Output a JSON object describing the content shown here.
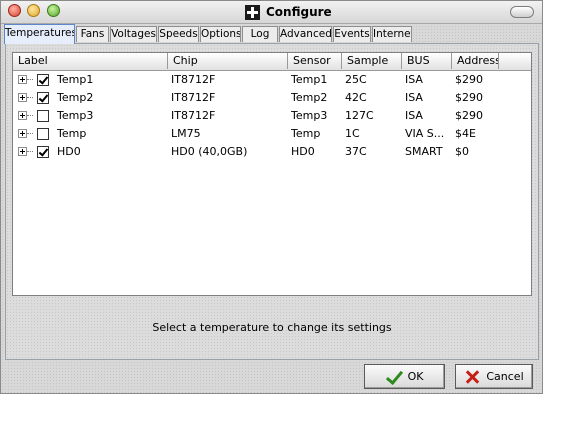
{
  "window": {
    "title": "Configure"
  },
  "tabs": [
    {
      "label": "Temperatures",
      "active": true
    },
    {
      "label": "Fans"
    },
    {
      "label": "Voltages"
    },
    {
      "label": "Speeds"
    },
    {
      "label": "Options"
    },
    {
      "label": "Log"
    },
    {
      "label": "Advanced"
    },
    {
      "label": "Events"
    },
    {
      "label": "Internet"
    }
  ],
  "table": {
    "columns": [
      "Label",
      "Chip",
      "Sensor",
      "Sample",
      "BUS",
      "Address"
    ],
    "rows": [
      {
        "checked": true,
        "label": "Temp1",
        "chip": "IT8712F",
        "sensor": "Temp1",
        "sample": "25C",
        "bus": "ISA",
        "address": "$290"
      },
      {
        "checked": true,
        "label": "Temp2",
        "chip": "IT8712F",
        "sensor": "Temp2",
        "sample": "42C",
        "bus": "ISA",
        "address": "$290"
      },
      {
        "checked": false,
        "label": "Temp3",
        "chip": "IT8712F",
        "sensor": "Temp3",
        "sample": "127C",
        "bus": "ISA",
        "address": "$290"
      },
      {
        "checked": false,
        "label": "Temp",
        "chip": "LM75",
        "sensor": "Temp",
        "sample": "1C",
        "bus": "VIA S...",
        "address": "$4E"
      },
      {
        "checked": true,
        "label": "HD0",
        "chip": "HD0 (40,0GB)",
        "sensor": "HD0",
        "sample": "37C",
        "bus": "SMART",
        "address": "$0"
      }
    ]
  },
  "status_text": "Select a temperature to change its settings",
  "buttons": {
    "ok": "OK",
    "cancel": "Cancel"
  }
}
